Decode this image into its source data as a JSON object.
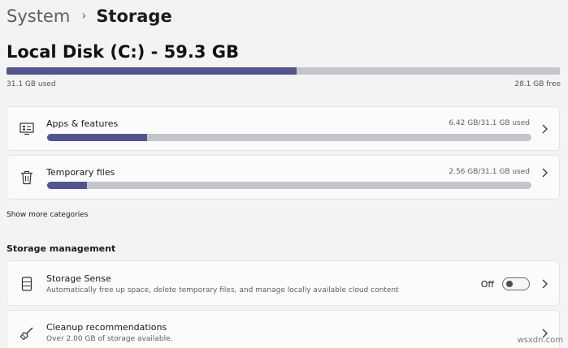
{
  "breadcrumb": {
    "parent": "System",
    "separator": "›",
    "current": "Storage"
  },
  "disk": {
    "title": "Local Disk (C:) - 59.3 GB",
    "used_label": "31.1 GB used",
    "free_label": "28.1 GB free",
    "used_fraction": 0.524
  },
  "categories": [
    {
      "title": "Apps & features",
      "usage": "6.42 GB/31.1 GB used",
      "fraction": 0.206,
      "icon": "apps-features-icon"
    },
    {
      "title": "Temporary files",
      "usage": "2.56 GB/31.1 GB used",
      "fraction": 0.082,
      "icon": "trash-icon"
    }
  ],
  "show_more": "Show more categories",
  "management": {
    "heading": "Storage management",
    "storage_sense": {
      "title": "Storage Sense",
      "subtitle": "Automatically free up space, delete temporary files, and manage locally available cloud content",
      "state": "Off",
      "icon": "storage-sense-icon"
    },
    "cleanup": {
      "title": "Cleanup recommendations",
      "subtitle": "Over 2.00 GB of storage available.",
      "icon": "broom-icon"
    }
  },
  "watermark": "wsxdn.com",
  "colors": {
    "bar_fill": "#505591",
    "bar_track": "#c3c6cb",
    "card_bg": "#fbfbfb",
    "page_bg": "#f3f3f3"
  }
}
